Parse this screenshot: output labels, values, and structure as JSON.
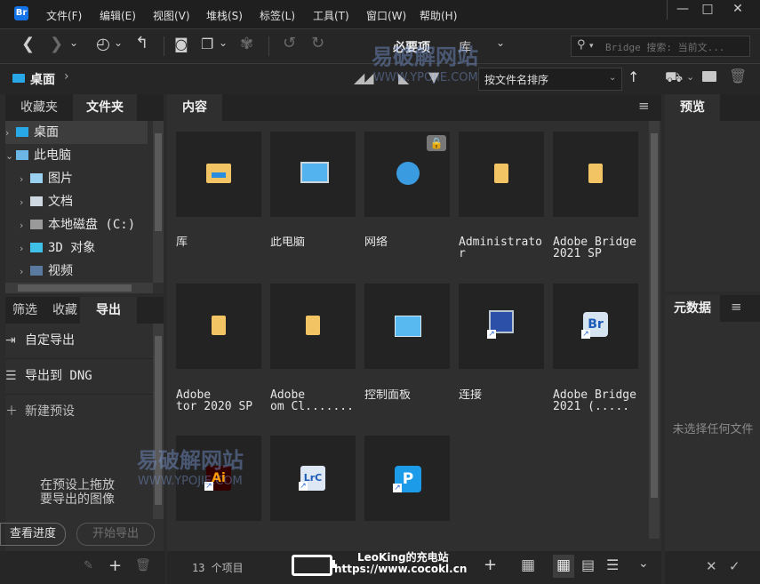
{
  "app": {
    "logo_text": "Br"
  },
  "menu": [
    "文件(F)",
    "编辑(E)",
    "视图(V)",
    "堆栈(S)",
    "标签(L)",
    "工具(T)",
    "窗口(W)",
    "帮助(H)"
  ],
  "window_controls": {
    "minimize": "—",
    "maximize": "□",
    "close": "✕"
  },
  "toolbar": {
    "workspace_essentials": "必要项",
    "workspace_library": "库",
    "search_placeholder": "Bridge 搜索: 当前文..."
  },
  "pathbar": {
    "location": "桌面",
    "sort_label": "按文件名排序"
  },
  "left_panel": {
    "tabs": [
      "收藏夹",
      "文件夹"
    ],
    "active_tab": "文件夹",
    "tree": [
      {
        "label": "桌面",
        "expanded": false,
        "selected": true,
        "icon": "desktop-icon"
      },
      {
        "label": "此电脑",
        "expanded": true,
        "selected": false,
        "icon": "computer-icon"
      },
      {
        "label": "图片",
        "expanded": false,
        "selected": false,
        "icon": "pictures-icon"
      },
      {
        "label": "文档",
        "expanded": false,
        "selected": false,
        "icon": "documents-icon"
      },
      {
        "label": "本地磁盘 (C:)",
        "expanded": false,
        "selected": false,
        "icon": "disk-icon"
      },
      {
        "label": "3D 对象",
        "expanded": false,
        "selected": false,
        "icon": "3d-objects-icon"
      },
      {
        "label": "视频",
        "expanded": false,
        "selected": false,
        "icon": "video-icon"
      }
    ]
  },
  "export_panel": {
    "tabs": [
      "筛选",
      "收藏",
      "导出"
    ],
    "active_tab": "导出",
    "items": [
      {
        "label": "自定导出",
        "icon": "export-icon"
      },
      {
        "label": "导出到 DNG",
        "icon": "list-icon"
      },
      {
        "label": "新建预设",
        "icon": "plus-icon"
      }
    ],
    "drop_hint_line1": "在预设上拖放",
    "drop_hint_line2": "要导出的图像",
    "view_progress": "查看进度",
    "start_export": "开始导出"
  },
  "content": {
    "tab_label": "内容",
    "item_count": "13 个项目",
    "items": [
      {
        "label": "库",
        "icon": "library-folder-icon"
      },
      {
        "label": "此电脑",
        "icon": "this-pc-icon"
      },
      {
        "label": "网络",
        "icon": "network-icon",
        "locked": true
      },
      {
        "label": "Administrato\nr",
        "icon": "folder-icon"
      },
      {
        "label": "Adobe Bridge\n2021 SP",
        "icon": "folder-icon"
      },
      {
        "label": "Adobe\ntor 2020 SP",
        "icon": "folder-icon"
      },
      {
        "label": "Adobe\nom Cl.......",
        "icon": "folder-icon"
      },
      {
        "label": "控制面板",
        "icon": "control-panel-icon"
      },
      {
        "label": "连接",
        "icon": "connect-shortcut-icon"
      },
      {
        "label": "Adobe Bridge\n2021 (.....",
        "icon": "bridge-shortcut-icon"
      },
      {
        "label": "",
        "icon": "illustrator-shortcut-icon",
        "app_text": "Ai"
      },
      {
        "label": "",
        "icon": "lightroom-classic-shortcut-icon",
        "app_text": "LrC"
      },
      {
        "label": "",
        "icon": "photoshop-p-shortcut-icon",
        "app_text": "P"
      }
    ]
  },
  "preview_panel": {
    "tab_label": "预览"
  },
  "metadata_panel": {
    "tab_label": "元数据",
    "empty_text": "未选择任何文件"
  },
  "watermarks": {
    "site_name": "易破解网站",
    "site_url": "WWW.YPOJIE.COM",
    "overlay_title": "LeoKing的充电站",
    "overlay_url": "https://www.cocokl.cn"
  },
  "colors": {
    "accent": "#1473e6",
    "folder": "#f2c463",
    "panel": "#2f2f2f",
    "tile": "#232323"
  }
}
